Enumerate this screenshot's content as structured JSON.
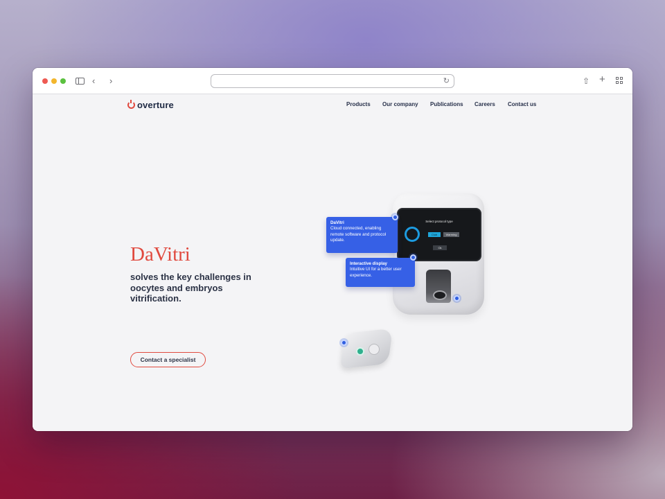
{
  "browser": {
    "address_value": "",
    "icons": [
      "sidebar-icon",
      "back-icon",
      "forward-icon",
      "reload-icon",
      "share-icon",
      "new-tab-icon",
      "tab-overview-icon"
    ]
  },
  "header": {
    "logo_text": "overture",
    "nav": [
      "Products",
      "Our company",
      "Publications",
      "Careers",
      "Contact us"
    ]
  },
  "hero": {
    "title": "DaVitri",
    "subtitle": "solves the key challenges in oocytes and embryos vitrification.",
    "cta_label": "Contact a specialist"
  },
  "device_screen": {
    "title": "Select protocol type",
    "options": [
      "Club",
      "Warming"
    ],
    "confirm": "Ok"
  },
  "callouts": [
    {
      "title": "DaVitri",
      "text": "Cloud connected, enabling remote software and protocol update."
    },
    {
      "title": "Interactive display",
      "text": "Intuitive UI for a better user experience."
    }
  ],
  "colors": {
    "brand_red": "#e0493e",
    "callout_blue": "#3660e6",
    "text_dark": "#2b3245"
  }
}
